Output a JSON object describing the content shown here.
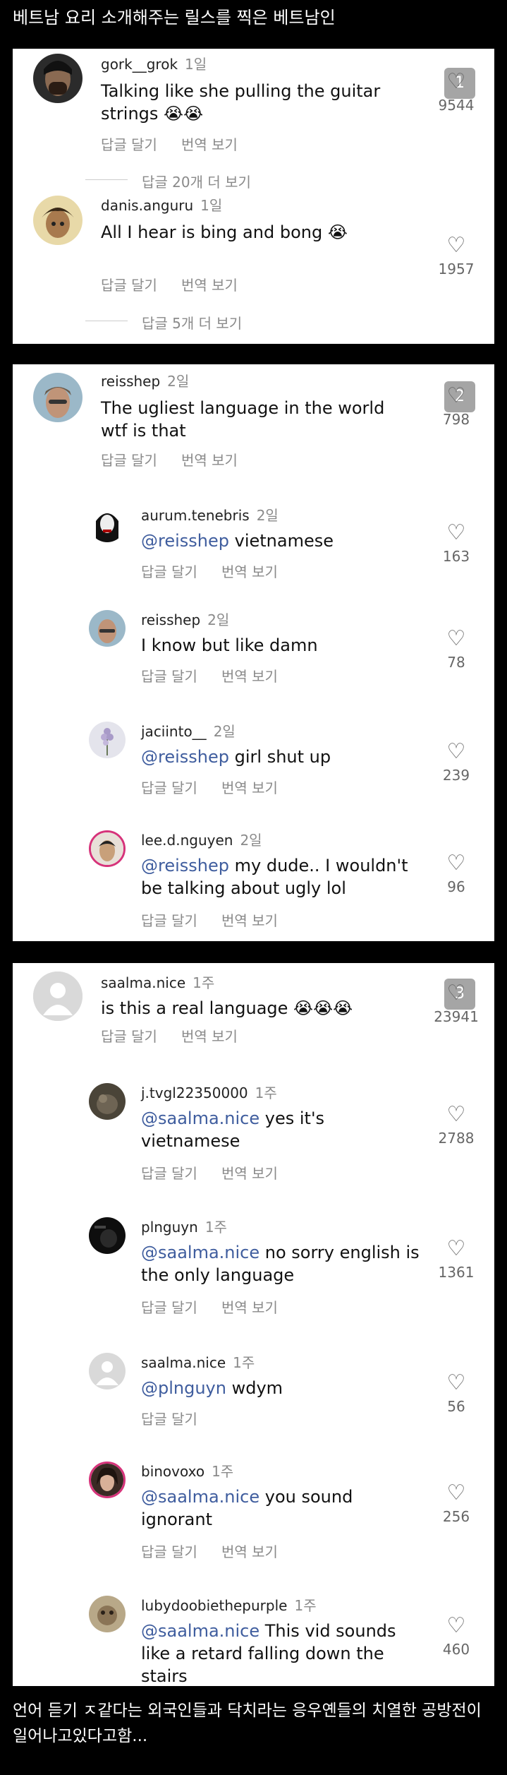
{
  "top_title": "베트남 요리 소개해주는 릴스를 찍은 베트남인",
  "footer_text": "언어 듣기 ㅈ같다는 외국인들과 닥치라는 응우옌들의 치열한 공방전이 일어나고있다고함...",
  "icon": {
    "heart": "♡"
  },
  "colors": {
    "mention": "#3f5d9e",
    "panel_bg": "#ffffff",
    "page_bg": "#000000",
    "meta": "#8a8a8a"
  },
  "comments": [
    {
      "username": "gork__grok",
      "time": "1일",
      "text": "Talking like she pulling the guitar strings 😭😭",
      "likes": "9544",
      "badge": "1",
      "reply": "답글 달기",
      "translate": "번역 보기",
      "more_replies": "답글 20개 더 보기"
    },
    {
      "username": "danis.anguru",
      "time": "1일",
      "text": "All I hear is bing and bong 😭",
      "likes": "1957",
      "reply": "답글 달기",
      "translate": "번역 보기",
      "more_replies": "답글 5개 더 보기"
    },
    {
      "username": "reisshep",
      "time": "2일",
      "text": "The ugliest language in the world wtf is that",
      "likes": "798",
      "badge": "2",
      "reply": "답글 달기",
      "translate": "번역 보기",
      "replies": [
        {
          "username": "aurum.tenebris",
          "time": "2일",
          "mention": "@reisshep",
          "text": " vietnamese",
          "likes": "163",
          "reply": "답글 달기",
          "translate": "번역 보기"
        },
        {
          "username": "reisshep",
          "time": "2일",
          "mention": "",
          "text": "I know but like damn",
          "likes": "78",
          "reply": "답글 달기",
          "translate": "번역 보기"
        },
        {
          "username": "jaciinto__",
          "time": "2일",
          "mention": "@reisshep",
          "text": " girl shut up",
          "likes": "239",
          "reply": "답글 달기",
          "translate": "번역 보기"
        },
        {
          "username": "lee.d.nguyen",
          "time": "2일",
          "mention": "@reisshep",
          "text": " my dude.. I wouldn't be talking about ugly lol",
          "likes": "96",
          "reply": "답글 달기",
          "translate": "번역 보기"
        }
      ]
    },
    {
      "username": "saalma.nice",
      "time": "1주",
      "text": "is this a real language 😭😭😭",
      "likes": "23941",
      "badge": "3",
      "reply": "답글 달기",
      "translate": "번역 보기",
      "replies": [
        {
          "username": "j.tvgl22350000",
          "time": "1주",
          "mention": "@saalma.nice",
          "text": " yes it's vietnamese",
          "likes": "2788",
          "reply": "답글 달기",
          "translate": "번역 보기"
        },
        {
          "username": "plnguyn",
          "time": "1주",
          "mention": "@saalma.nice",
          "text": " no sorry english is the only language",
          "likes": "1361",
          "reply": "답글 달기",
          "translate": "번역 보기"
        },
        {
          "username": "saalma.nice",
          "time": "1주",
          "mention": "@plnguyn",
          "text": " wdym",
          "likes": "56",
          "reply": "답글 달기",
          "translate": ""
        },
        {
          "username": "binovoxo",
          "time": "1주",
          "mention": "@saalma.nice",
          "text": " you sound ignorant",
          "likes": "256",
          "reply": "답글 달기",
          "translate": "번역 보기"
        },
        {
          "username": "lubydoobiethepurple",
          "time": "1주",
          "mention": "@saalma.nice",
          "text": " This vid sounds like a retard falling down the stairs",
          "likes": "460",
          "reply": "",
          "translate": ""
        }
      ]
    }
  ]
}
